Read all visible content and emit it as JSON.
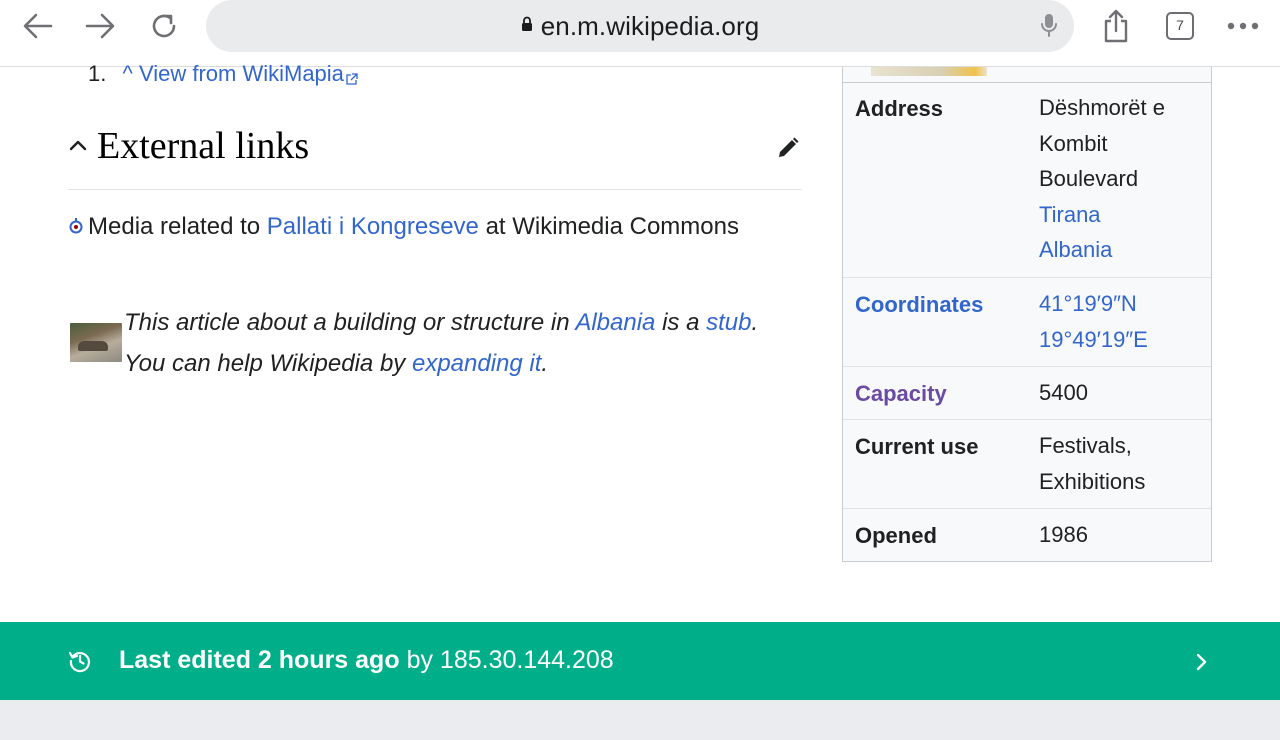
{
  "browser": {
    "url": "en.m.wikipedia.org",
    "tab_count": "7",
    "icons": {
      "back": "arrow-left-icon",
      "forward": "arrow-right-icon",
      "reload": "reload-icon",
      "lock": "lock-icon",
      "mic": "microphone-icon",
      "share": "share-icon",
      "tabs": "tabs-icon",
      "menu": "more-icon"
    }
  },
  "references": {
    "item_number": "1.",
    "caret": "^",
    "link_text": "View from WikiMapia"
  },
  "external_links": {
    "heading": "External links",
    "media_prefix": "Media related to",
    "media_link": "Pallati i Kongreseve",
    "media_suffix": "at Wikimedia Commons"
  },
  "stub": {
    "part1": "This article about a building or structure in",
    "link1": "Albania",
    "part2": "is a",
    "link2": "stub",
    "part3": ". You can help Wikipedia by",
    "link3": "expanding it",
    "part4": "."
  },
  "infobox": {
    "rows": [
      {
        "label": "Address",
        "values": [
          "Dëshmorët e",
          "Kombit",
          "Boulevard"
        ],
        "links": [
          "Tirana",
          "Albania"
        ]
      },
      {
        "label": "Coordinates",
        "values": [
          "41°19′9″N",
          "19°49′19″E"
        ]
      },
      {
        "label": "Capacity",
        "values": [
          "5400"
        ]
      },
      {
        "label": "Current use",
        "values": [
          "Festivals,",
          "Exhibitions"
        ]
      },
      {
        "label": "Opened",
        "values": [
          "1986"
        ]
      }
    ]
  },
  "footer": {
    "last_edited_bold": "Last edited 2 hours ago",
    "by_text": "by 185.30.144.208"
  },
  "colors": {
    "link": "#3366cc",
    "visited_link": "#6b4ba1",
    "footer_bg": "#00af89",
    "infobox_bg": "#f8f9fa"
  }
}
